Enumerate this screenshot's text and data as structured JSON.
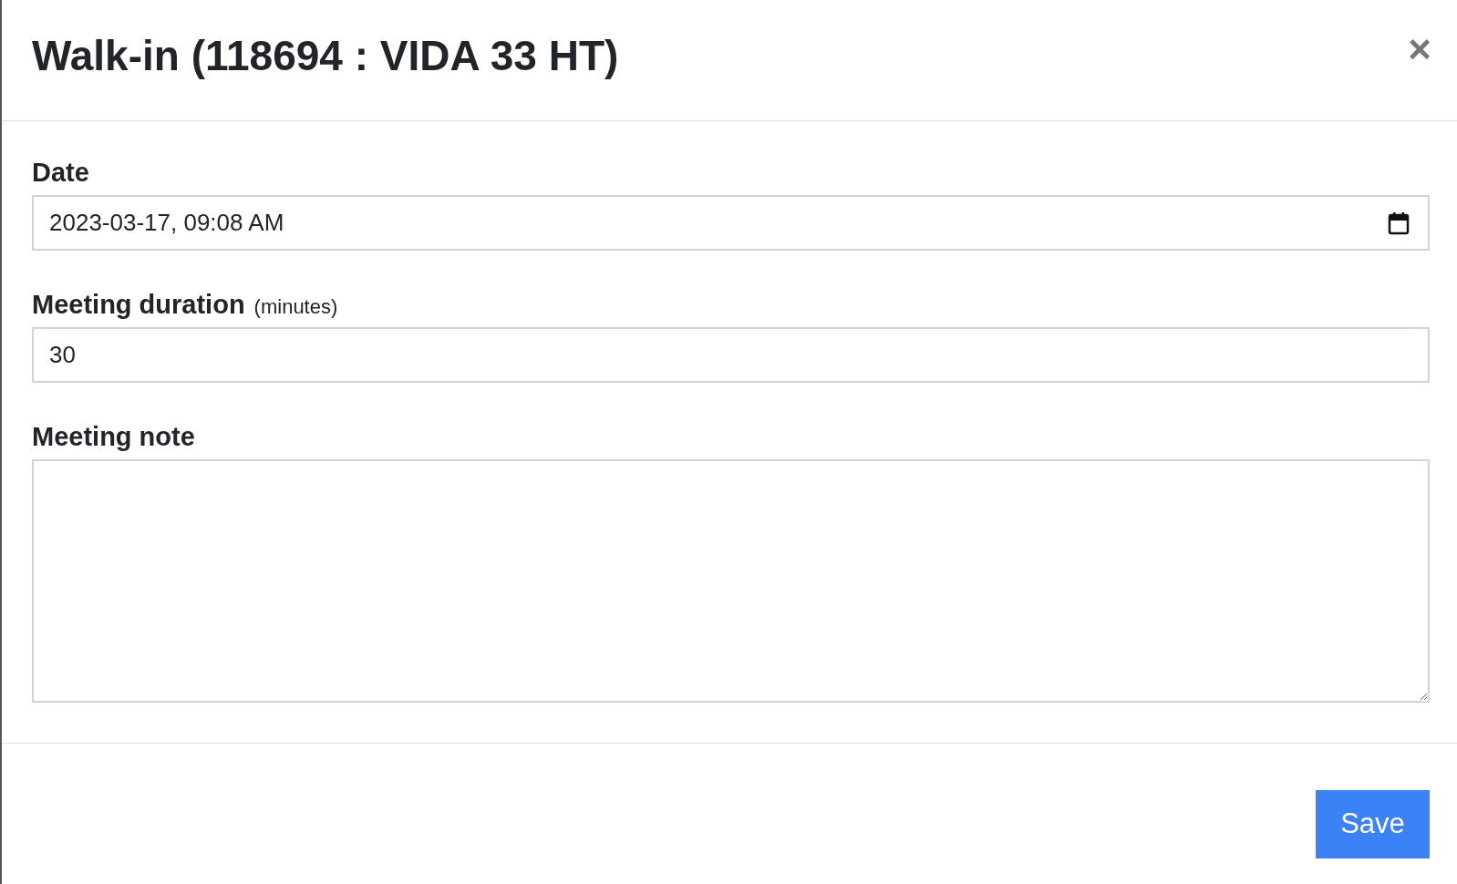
{
  "dialog": {
    "title": "Walk-in (118694 : VIDA 33 HT)",
    "close": "×"
  },
  "fields": [
    {
      "kind": "datetime",
      "label": "Date",
      "value": "2023-03-17, 09:08  AM"
    },
    {
      "kind": "text",
      "label": "Meeting duration",
      "hint": "(minutes)",
      "value": "30"
    },
    {
      "kind": "textarea",
      "label": "Meeting note"
    }
  ],
  "footer": {
    "save": "Save"
  }
}
